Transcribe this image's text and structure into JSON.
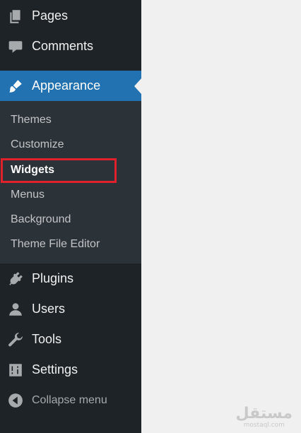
{
  "menu": {
    "pages": {
      "label": "Pages",
      "icon": "pages-icon"
    },
    "comments": {
      "label": "Comments",
      "icon": "comment-icon"
    },
    "appearance": {
      "label": "Appearance",
      "icon": "paintbrush-icon"
    },
    "plugins": {
      "label": "Plugins",
      "icon": "plug-icon"
    },
    "users": {
      "label": "Users",
      "icon": "user-icon"
    },
    "tools": {
      "label": "Tools",
      "icon": "wrench-icon"
    },
    "settings": {
      "label": "Settings",
      "icon": "sliders-icon"
    },
    "collapse": {
      "label": "Collapse menu",
      "icon": "collapse-icon"
    }
  },
  "submenu": [
    "Themes",
    "Customize",
    "Widgets",
    "Menus",
    "Background",
    "Theme File Editor"
  ],
  "highlighted_item": "Widgets",
  "watermark": {
    "arabic": "مستقل",
    "latin": "mostaql.com"
  },
  "colors": {
    "sidebar": "#1d2327",
    "submenu": "#2c3338",
    "accent": "#2271b1",
    "highlight_border": "#e0212b",
    "content_bg": "#f0f0f1"
  }
}
